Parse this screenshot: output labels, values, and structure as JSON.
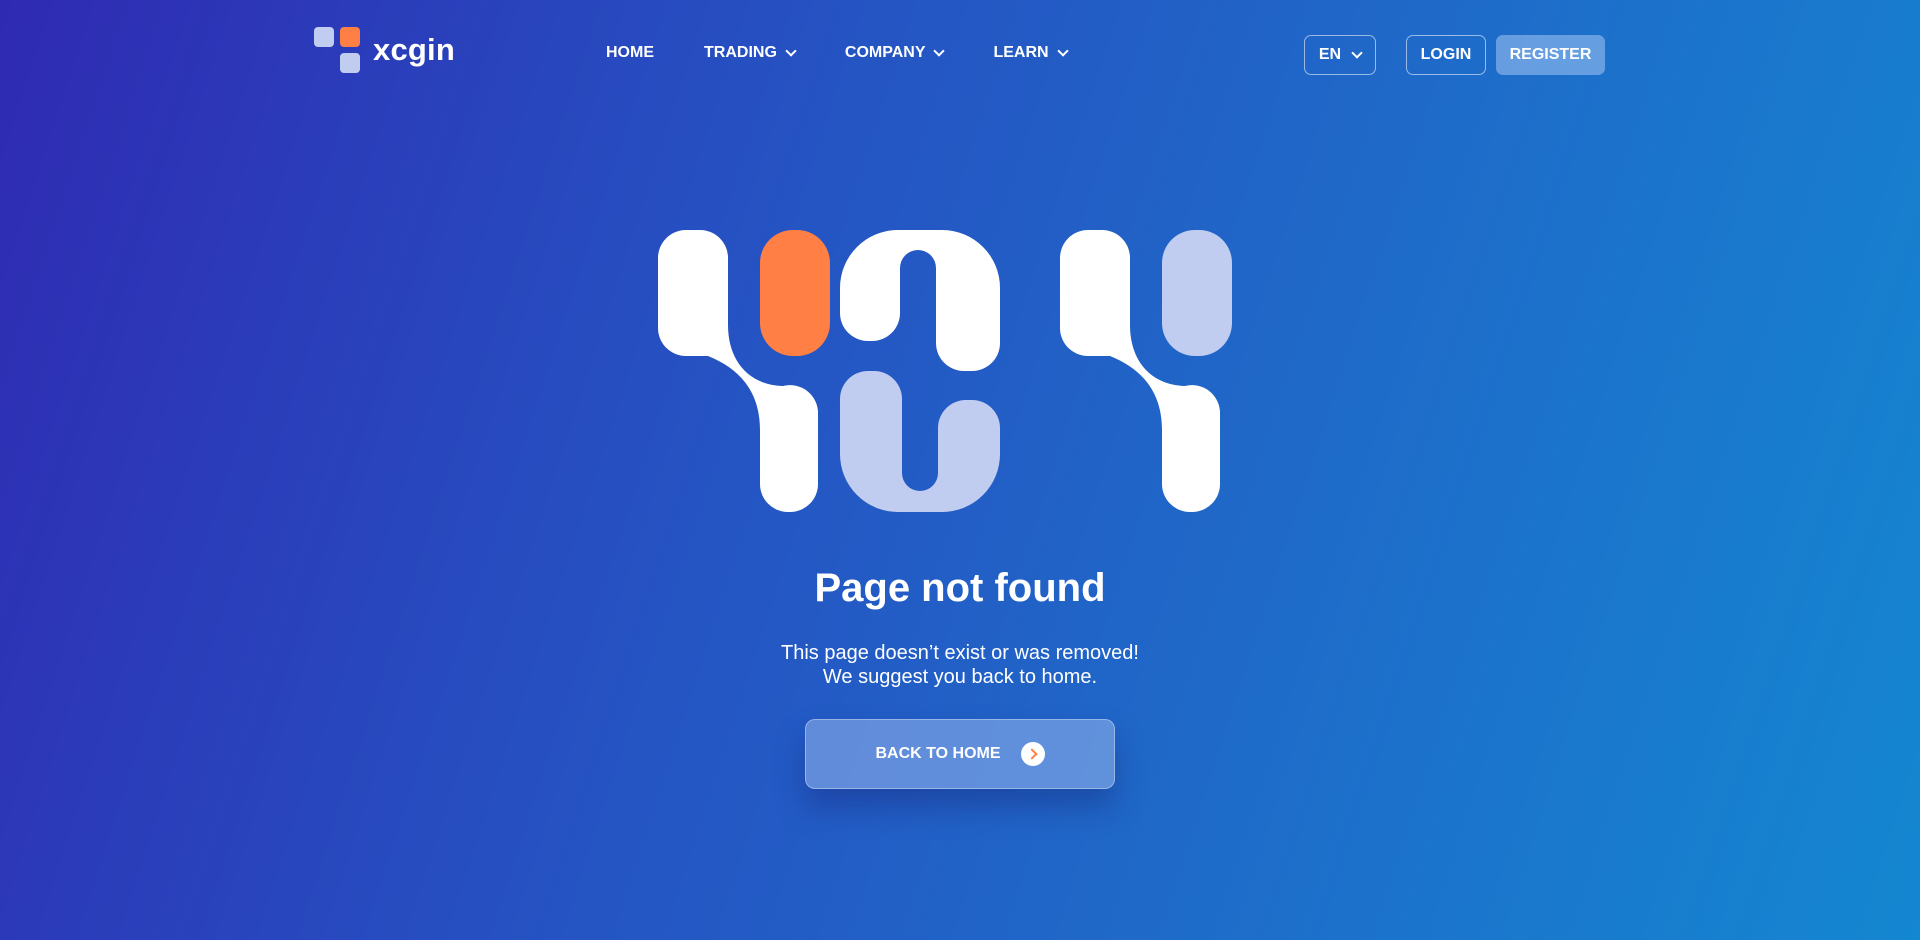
{
  "header": {
    "brand": "xcgin",
    "nav": [
      {
        "label": "HOME",
        "dropdown": false
      },
      {
        "label": "TRADING",
        "dropdown": true
      },
      {
        "label": "COMPANY",
        "dropdown": true
      },
      {
        "label": "LEARN",
        "dropdown": true
      }
    ],
    "language": "EN",
    "login_label": "LOGIN",
    "register_label": "REGISTER"
  },
  "error": {
    "code_graphic": "404",
    "title": "Page not found",
    "line1": "This page doesn’t exist or was removed!",
    "line2": "We suggest you back to home.",
    "button_label": "BACK TO HOME"
  },
  "colors": {
    "accent": "#ff7f45",
    "light_block": "#c1cdf0",
    "white": "#ffffff",
    "gradient_start": "#2f2ab2",
    "gradient_end": "#1487d1"
  },
  "icons": [
    "logo-icon",
    "chevron-down-icon",
    "arrow-right-icon"
  ]
}
